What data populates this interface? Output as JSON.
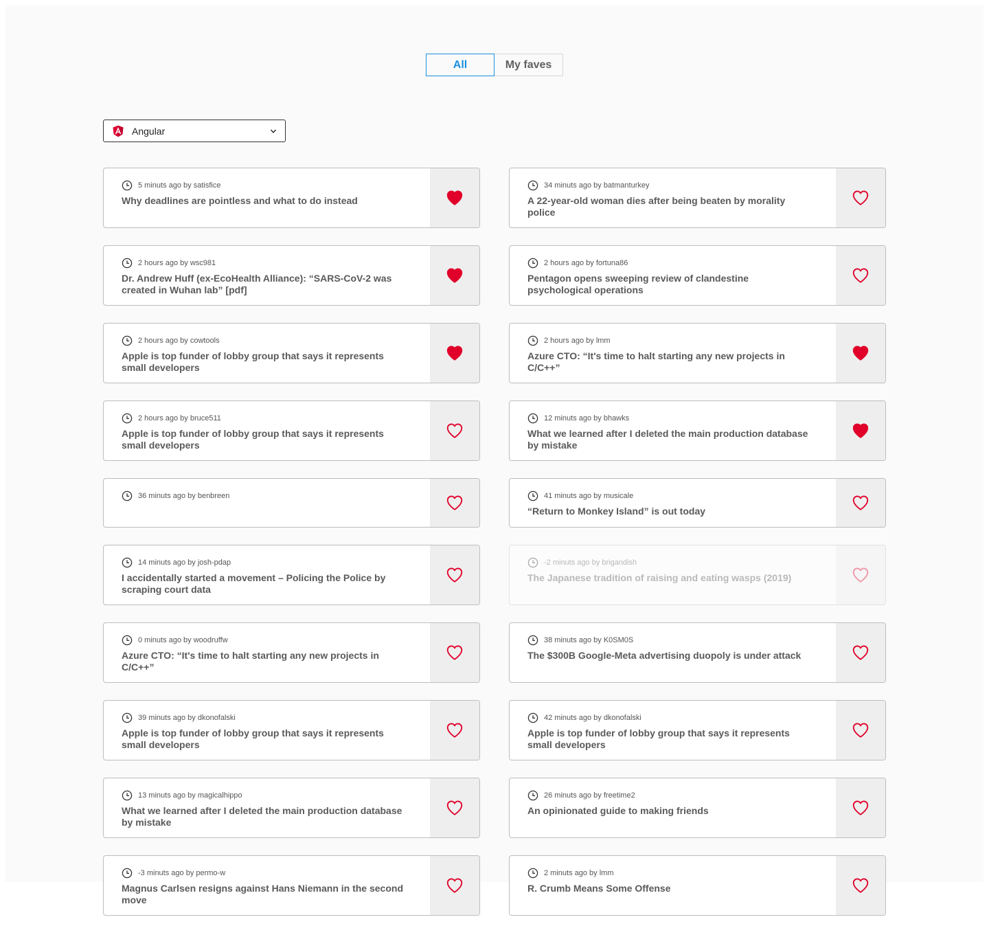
{
  "tabs": [
    {
      "label": "All",
      "active": true
    },
    {
      "label": "My faves",
      "active": false
    }
  ],
  "framework_select": {
    "value": "Angular",
    "icon": "angular-logo-icon"
  },
  "colors": {
    "accent": "#1a8fe0",
    "heart": "#e0002a"
  },
  "posts": [
    {
      "meta": "5 minuts ago by satisfice",
      "title": "Why deadlines are pointless and what to do instead",
      "faved": true,
      "faded": false
    },
    {
      "meta": "34 minuts ago by batmanturkey",
      "title": "A 22-year-old woman dies after being beaten by morality police",
      "faved": false,
      "faded": false
    },
    {
      "meta": "2 hours ago by wsc981",
      "title": "Dr. Andrew Huff (ex-EcoHealth Alliance): “SARS-CoV-2 was created in Wuhan lab” [pdf]",
      "faved": true,
      "faded": false
    },
    {
      "meta": "2 hours ago by fortuna86",
      "title": "Pentagon opens sweeping review of clandestine psychological operations",
      "faved": false,
      "faded": false
    },
    {
      "meta": "2 hours ago by cowtools",
      "title": "Apple is top funder of lobby group that says it represents small developers",
      "faved": true,
      "faded": false
    },
    {
      "meta": "2 hours ago by lmm",
      "title": "Azure CTO: “It's time to halt starting any new projects in C/C++”",
      "faved": true,
      "faded": false
    },
    {
      "meta": "2 hours ago by bruce511",
      "title": "Apple is top funder of lobby group that says it represents small developers",
      "faved": false,
      "faded": false
    },
    {
      "meta": "12 minuts ago by bhawks",
      "title": "What we learned after I deleted the main production database by mistake",
      "faved": true,
      "faded": false
    },
    {
      "meta": "36 minuts ago by benbreen",
      "title": "",
      "faved": false,
      "faded": false
    },
    {
      "meta": "41 minuts ago by musicale",
      "title": "“Return to Monkey Island” is out today",
      "faved": false,
      "faded": false
    },
    {
      "meta": "14 minuts ago by josh-pdap",
      "title": "I accidentally started a movement – Policing the Police by scraping court data",
      "faved": false,
      "faded": false
    },
    {
      "meta": "-2 minuts ago by brigandish",
      "title": "The Japanese tradition of raising and eating wasps (2019)",
      "faved": false,
      "faded": true
    },
    {
      "meta": "0 minuts ago by woodruffw",
      "title": "Azure CTO: “It's time to halt starting any new projects in C/C++”",
      "faved": false,
      "faded": false
    },
    {
      "meta": "38 minuts ago by K0SM0S",
      "title": "The $300B Google-Meta advertising duopoly is under attack",
      "faved": false,
      "faded": false
    },
    {
      "meta": "39 minuts ago by dkonofalski",
      "title": "Apple is top funder of lobby group that says it represents small developers",
      "faved": false,
      "faded": false
    },
    {
      "meta": "42 minuts ago by dkonofalski",
      "title": "Apple is top funder of lobby group that says it represents small developers",
      "faved": false,
      "faded": false
    },
    {
      "meta": "13 minuts ago by magicalhippo",
      "title": "What we learned after I deleted the main production database by mistake",
      "faved": false,
      "faded": false
    },
    {
      "meta": "26 minuts ago by freetime2",
      "title": "An opinionated guide to making friends",
      "faved": false,
      "faded": false
    },
    {
      "meta": "-3 minuts ago by permo-w",
      "title": "Magnus Carlsen resigns against Hans Niemann in the second move",
      "faved": false,
      "faded": false
    },
    {
      "meta": "2 minuts ago by lmm",
      "title": "R. Crumb Means Some Offense",
      "faved": false,
      "faded": false
    }
  ]
}
